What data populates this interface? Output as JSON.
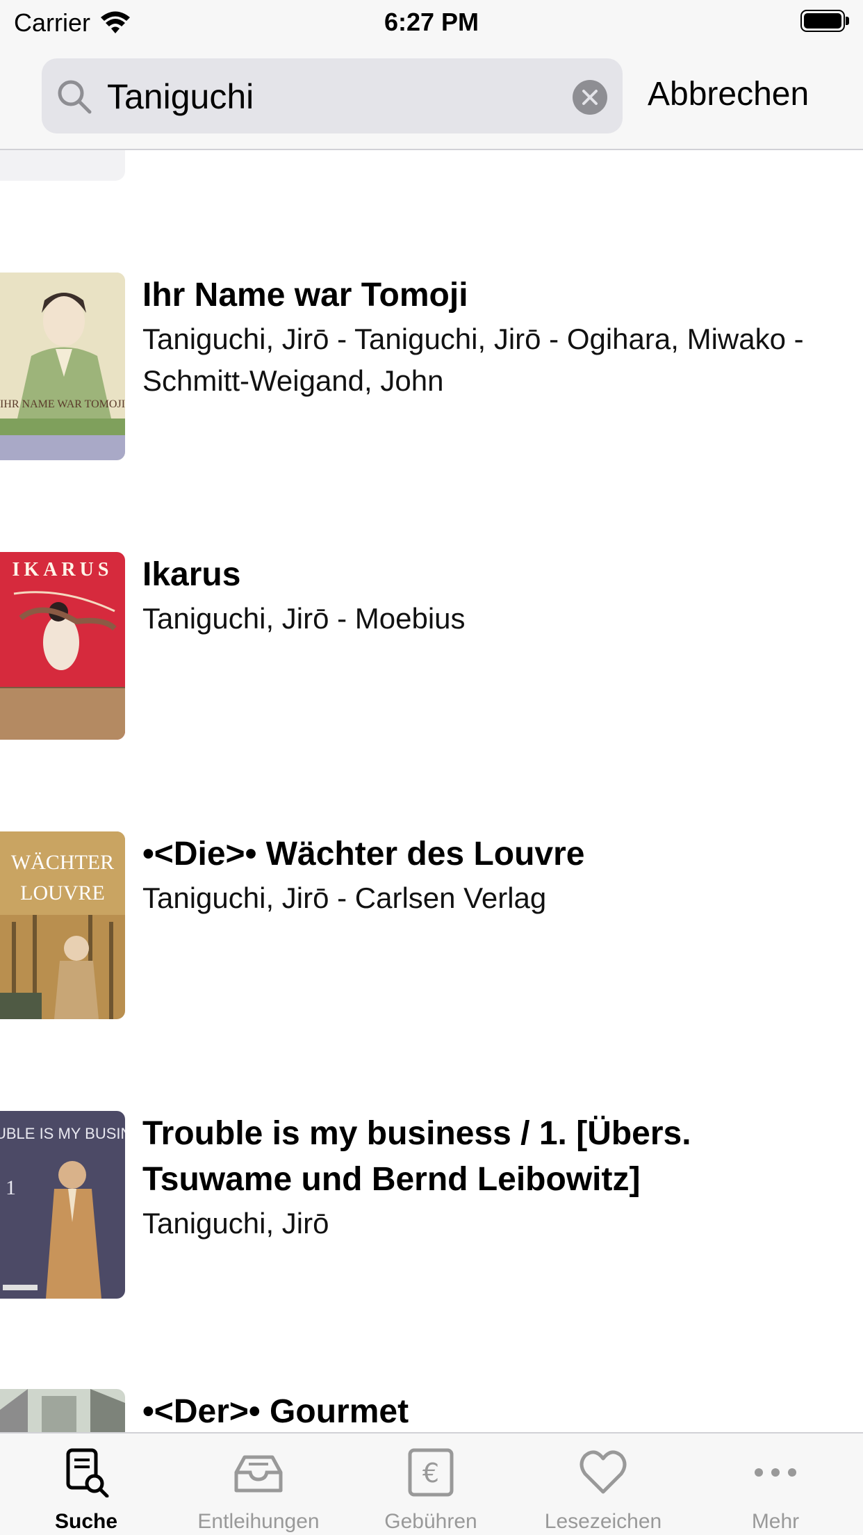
{
  "status_bar": {
    "carrier": "Carrier",
    "time": "6:27 PM",
    "icons": [
      "wifi-icon",
      "battery-icon"
    ]
  },
  "search": {
    "value": "Taniguchi",
    "cancel_label": "Abbrechen",
    "icons": [
      "search-icon",
      "clear-icon"
    ]
  },
  "results": [
    {
      "title": "Ihr Name war Tomoji",
      "authors": "Taniguchi, Jirō - Taniguchi, Jirō - Ogihara, Miwako - Schmitt-Weigand, John",
      "cover_colors": [
        "#efe9d2",
        "#7c9a63"
      ]
    },
    {
      "title": "Ikarus",
      "authors": "Taniguchi, Jirō - Moebius",
      "cover_colors": [
        "#d8283a",
        "#f3e6d8"
      ]
    },
    {
      "title": "•<Die>• Wächter des Louvre",
      "authors": "Taniguchi, Jirō - Carlsen Verlag",
      "cover_colors": [
        "#c79a54",
        "#3f4a3a"
      ]
    },
    {
      "title": "Trouble is my business / 1. [Übers. Tsuwame und Bernd Leibowitz]",
      "authors": "Taniguchi, Jirō",
      "cover_colors": [
        "#4d4a68",
        "#c4945e"
      ]
    },
    {
      "title": "•<Der>• Gourmet",
      "authors": "",
      "cover_colors": [
        "#8c8c8c",
        "#cfd6cc"
      ]
    }
  ],
  "tabs": [
    {
      "label": "Suche",
      "icon": "search-document-icon",
      "active": true
    },
    {
      "label": "Entleihungen",
      "icon": "tray-icon",
      "active": false
    },
    {
      "label": "Gebühren",
      "icon": "euro-icon",
      "active": false
    },
    {
      "label": "Lesezeichen",
      "icon": "heart-icon",
      "active": false
    },
    {
      "label": "Mehr",
      "icon": "more-icon",
      "active": false
    }
  ],
  "colors": {
    "bar_background": "#f7f7f7",
    "search_field": "#e4e4e9",
    "inactive_tab": "#999999",
    "active_tab": "#000000"
  }
}
